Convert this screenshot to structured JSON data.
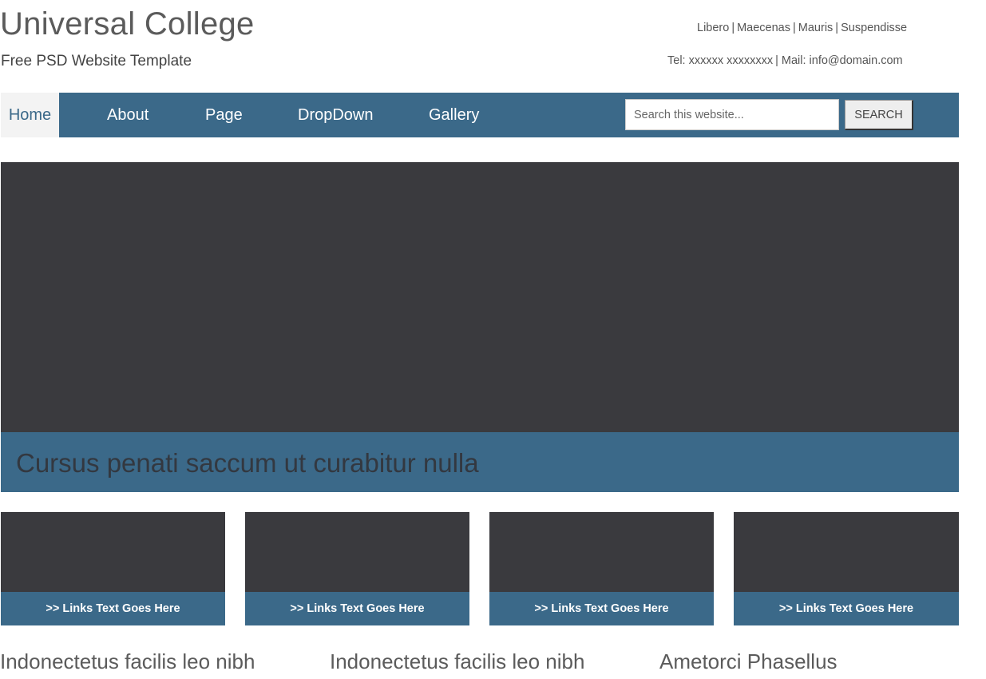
{
  "header": {
    "site_title": "Universal College",
    "tagline": "Free PSD Website Template",
    "top_links": [
      "Libero",
      "Maecenas",
      "Mauris",
      "Suspendisse"
    ],
    "top_links_separator": "|",
    "contact": {
      "tel": "Tel: xxxxxx xxxxxxxx",
      "separator": "|",
      "mail": "Mail: info@domain.com"
    }
  },
  "nav": {
    "items": [
      {
        "label": "Home",
        "active": true
      },
      {
        "label": "About",
        "active": false
      },
      {
        "label": "Page",
        "active": false
      },
      {
        "label": "DropDown",
        "active": false
      },
      {
        "label": "Gallery",
        "active": false
      }
    ],
    "search": {
      "placeholder": "Search this website...",
      "value": "",
      "button_label": "SEARCH"
    }
  },
  "hero": {
    "caption": "Cursus penati saccum ut curabitur nulla"
  },
  "features": [
    {
      "link": ">> Links Text Goes Here"
    },
    {
      "link": ">> Links Text Goes Here"
    },
    {
      "link": ">> Links Text Goes Here"
    },
    {
      "link": ">> Links Text Goes Here"
    }
  ],
  "columns": [
    {
      "heading": "Indonectetus facilis leo nibh"
    },
    {
      "heading": "Indonectetus facilis leo nibh"
    },
    {
      "heading": "Ametorci Phasellus"
    }
  ],
  "colors": {
    "accent": "#3b6989",
    "placeholder_image": "#3a3a3e",
    "active_nav_bg": "#f3f3f3"
  }
}
